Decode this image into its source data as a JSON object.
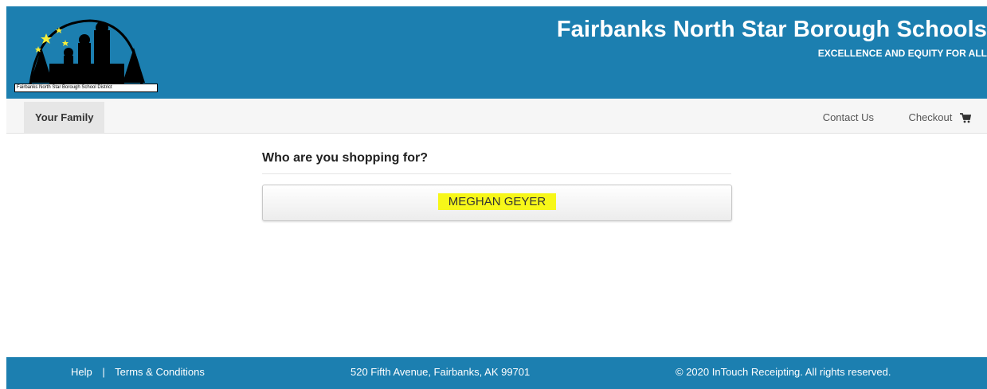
{
  "header": {
    "logo_caption": "Fairbanks North Star Borough School District",
    "title": "Fairbanks North Star Borough Schools",
    "tagline": "EXCELLENCE AND EQUITY FOR ALL"
  },
  "nav": {
    "your_family": "Your Family",
    "contact_us": "Contact Us",
    "checkout": "Checkout",
    "checkout_icon": "cart-icon"
  },
  "main": {
    "question": "Who are you shopping for?",
    "students": [
      "MEGHAN GEYER"
    ]
  },
  "footer": {
    "help": "Help",
    "separator": "|",
    "terms": "Terms & Conditions",
    "address": "520 Fifth Avenue, Fairbanks, AK 99701",
    "copyright": "© 2020 InTouch Receipting. All rights reserved."
  },
  "colors": {
    "brand_blue": "#1c7fb0",
    "highlight": "#f7f719"
  }
}
